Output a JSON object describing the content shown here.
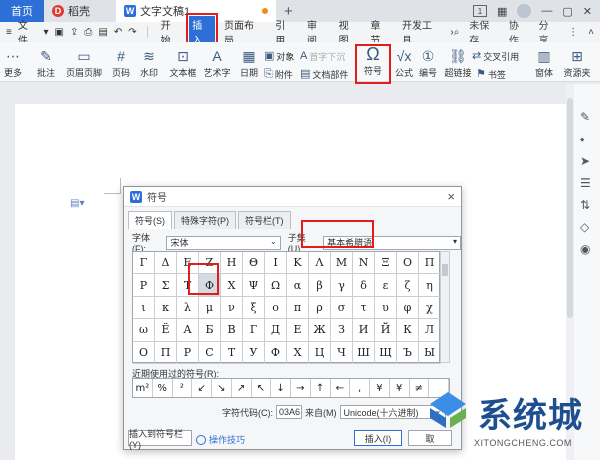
{
  "titlebar": {
    "home_tab": "首页",
    "tabs": [
      {
        "label": "稻壳",
        "icon": "daoke-logo-icon"
      },
      {
        "label": "文字文稿1",
        "icon": "wps-doc-icon"
      }
    ],
    "new_tab": "+",
    "window_buttons": [
      "1"
    ]
  },
  "menubar": {
    "file_label": "文件",
    "items": [
      "开始",
      "插入",
      "页面布局",
      "引用",
      "审阅",
      "视图",
      "章节",
      "开发工具"
    ],
    "active": "插入",
    "right": [
      "未保存",
      "协作",
      "分享"
    ]
  },
  "ribbon": {
    "buttons": [
      {
        "label": "更多",
        "icon": "more-icon"
      },
      {
        "label": "批注",
        "icon": "comment-icon"
      },
      {
        "label": "页眉页脚",
        "icon": "header-footer-icon"
      },
      {
        "label": "页码",
        "icon": "page-number-icon"
      },
      {
        "label": "水印",
        "icon": "watermark-icon"
      },
      {
        "label": "文本框",
        "icon": "textbox-icon"
      },
      {
        "label": "艺术字",
        "icon": "wordart-icon"
      },
      {
        "label": "日期",
        "icon": "date-icon"
      },
      {
        "label": "附件",
        "icon": "attachment-icon"
      },
      {
        "label": "对象",
        "icon": "object-icon"
      },
      {
        "label": "首字下沉",
        "icon": "dropcap-icon"
      },
      {
        "label": "文档部件",
        "icon": "doc-parts-icon"
      },
      {
        "label": "符号",
        "icon": "omega-symbol-icon"
      },
      {
        "label": "公式",
        "icon": "formula-icon"
      },
      {
        "label": "编号",
        "icon": "numbering-icon"
      },
      {
        "label": "交叉引用",
        "icon": "cross-ref-icon"
      },
      {
        "label": "超链接",
        "icon": "hyperlink-icon"
      },
      {
        "label": "书签",
        "icon": "bookmark-icon"
      },
      {
        "label": "窗体",
        "icon": "form-icon"
      },
      {
        "label": "资源夹",
        "icon": "resource-icon"
      }
    ]
  },
  "dialog": {
    "title": "符号",
    "close": "×",
    "tabs": [
      "符号(S)",
      "特殊字符(P)",
      "符号栏(T)"
    ],
    "font_label": "字体(F):",
    "font_value": "宋体",
    "subset_label": "子集(U):",
    "subset_value": "基本希腊语",
    "symbols": [
      "Γ",
      "Δ",
      "Ε",
      "Ζ",
      "Η",
      "Θ",
      "Ι",
      "Κ",
      "Λ",
      "Μ",
      "Ν",
      "Ξ",
      "Ο",
      "Π",
      "Ρ",
      "Σ",
      "Τ",
      "Φ",
      "Χ",
      "Ψ",
      "Ω",
      "α",
      "β",
      "γ",
      "δ",
      "ε",
      "ζ",
      "η",
      "ι",
      "κ",
      "λ",
      "μ",
      "ν",
      "ξ",
      "ο",
      "π",
      "ρ",
      "σ",
      "τ",
      "υ",
      "φ",
      "χ",
      "ω",
      "Ё",
      "А",
      "Б",
      "В",
      "Г",
      "Д",
      "Е",
      "Ж",
      "З",
      "И",
      "Й",
      "К",
      "Л",
      "О",
      "П",
      "Р",
      "С",
      "Т",
      "У",
      "Ф",
      "Х",
      "Ц",
      "Ч",
      "Ш",
      "Щ",
      "Ъ",
      "Ы"
    ],
    "selected_symbol": "Φ",
    "recent_label": "近期使用过的符号(R):",
    "recent": [
      "m²",
      "%",
      "²",
      "↙",
      "↘",
      "↗",
      "↖",
      "↓",
      "→",
      "↑",
      "←",
      ",",
      "¥",
      "¥",
      "≠",
      ""
    ],
    "code_label": "字符代码(C):",
    "code_value": "03A6",
    "from_label": "来自(M)",
    "from_value": "Unicode(十六进制)",
    "insert_to_bar": "插入到符号栏(Y)",
    "tips": "操作技巧",
    "insert_button": "插入(I)",
    "cancel_button": "取"
  },
  "watermark": {
    "title": "系统城",
    "subtitle": "XITONGCHENG.COM"
  }
}
